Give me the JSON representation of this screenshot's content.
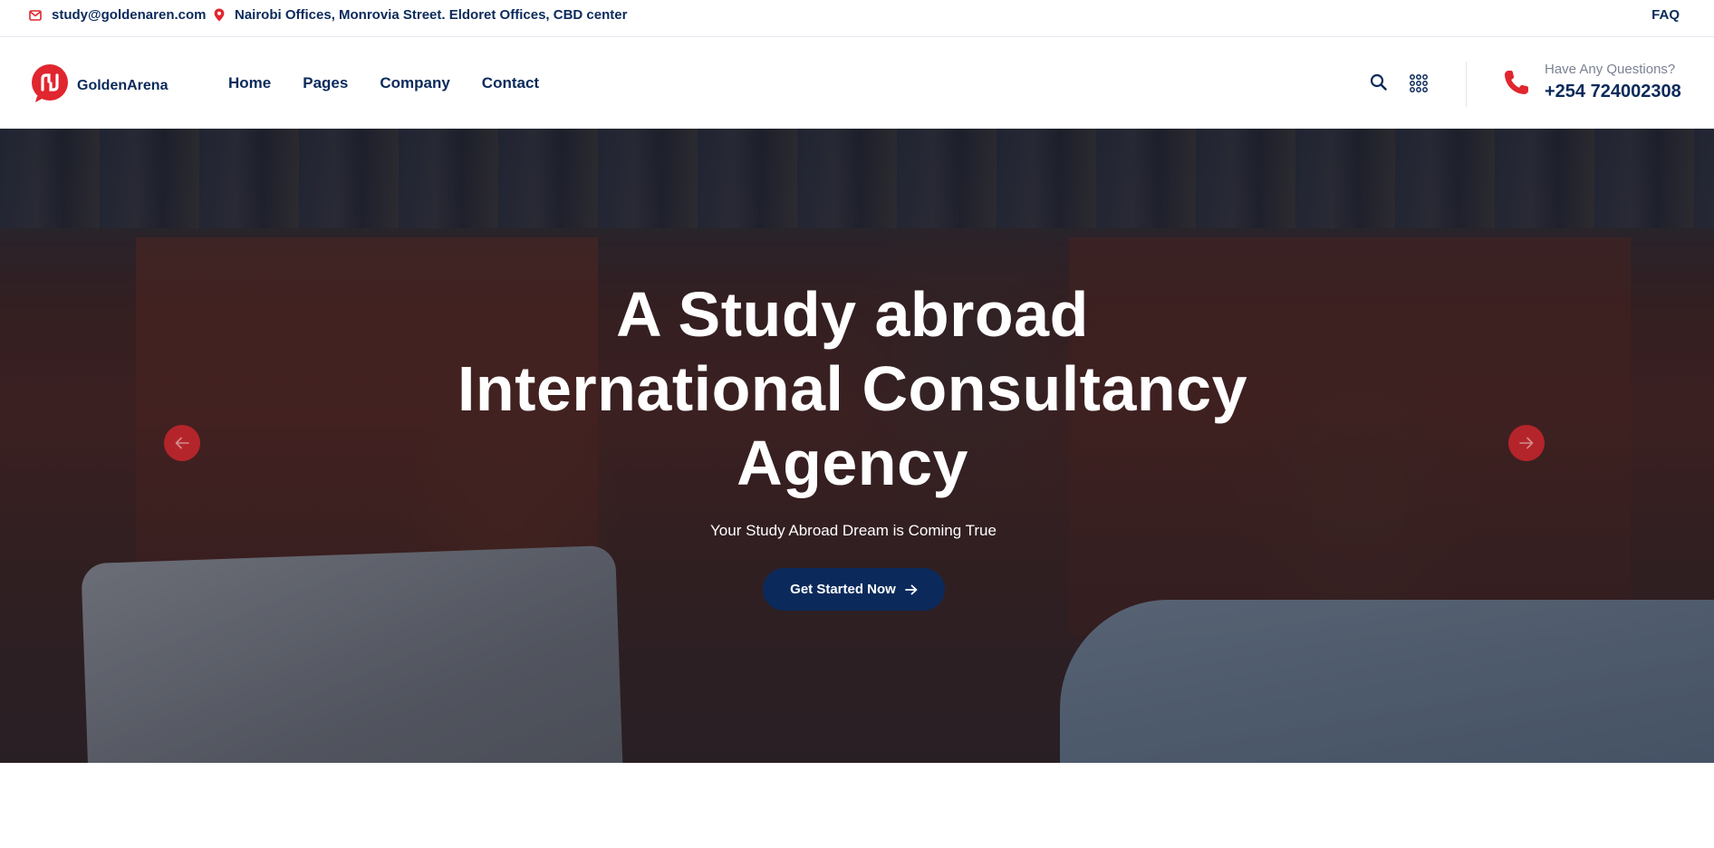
{
  "topbar": {
    "email": "study@goldenaren.com",
    "address": "Nairobi Offices, Monrovia Street. Eldoret Offices, CBD center",
    "faq": "FAQ",
    "icons": {
      "email": "mail-icon",
      "address": "map-pin-icon"
    }
  },
  "header": {
    "brand": "GoldenArena",
    "nav": [
      {
        "label": "Home"
      },
      {
        "label": "Pages"
      },
      {
        "label": "Company"
      },
      {
        "label": "Contact"
      }
    ],
    "icons": {
      "search": "search-icon",
      "grid": "grid-menu-icon",
      "phone": "phone-icon"
    },
    "question": "Have Any Questions?",
    "phone": "+254 724002308"
  },
  "hero": {
    "title_lines": [
      "A Study abroad",
      "International Consultancy",
      "Agency"
    ],
    "subtitle": "Your Study Abroad Dream is Coming True",
    "cta": "Get Started Now",
    "icons": {
      "prev": "arrow-left-icon",
      "next": "arrow-right-icon",
      "cta": "arrow-right-icon"
    }
  },
  "colors": {
    "navy": "#0b2a5b",
    "accent_red": "#e0262f",
    "muted_text": "#7a8293"
  }
}
